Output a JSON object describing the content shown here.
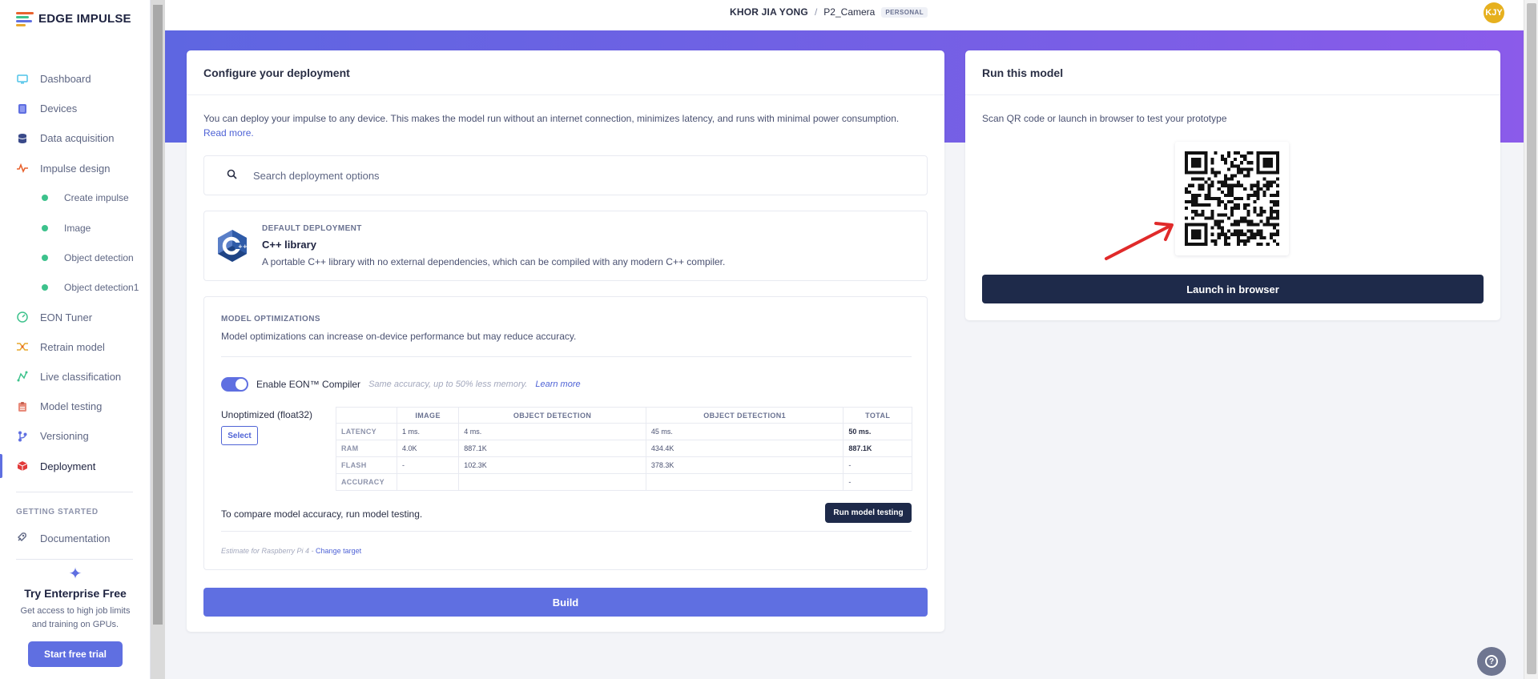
{
  "app": {
    "logo_text": "EDGE IMPULSE"
  },
  "header": {
    "owner": "KHOR JIA YONG",
    "separator": "/",
    "project": "P2_Camera",
    "badge": "PERSONAL",
    "avatar_initials": "KJY"
  },
  "sidebar": {
    "items": [
      {
        "label": "Dashboard",
        "icon": "monitor-icon",
        "color": "#4fc3e8"
      },
      {
        "label": "Devices",
        "icon": "device-icon",
        "color": "#5f6fe1"
      },
      {
        "label": "Data acquisition",
        "icon": "database-icon",
        "color": "#3a4a8a"
      },
      {
        "label": "Impulse design",
        "icon": "pulse-icon",
        "color": "#e8622e"
      },
      {
        "label": "Create impulse",
        "sub": true
      },
      {
        "label": "Image",
        "sub": true
      },
      {
        "label": "Object detection",
        "sub": true
      },
      {
        "label": "Object detection1",
        "sub": true
      },
      {
        "label": "EON Tuner",
        "icon": "gauge-icon",
        "color": "#3dc28c"
      },
      {
        "label": "Retrain model",
        "icon": "shuffle-icon",
        "color": "#e8a92e"
      },
      {
        "label": "Live classification",
        "icon": "graph-icon",
        "color": "#3dc28c"
      },
      {
        "label": "Model testing",
        "icon": "clipboard-icon",
        "color": "#e88a7a"
      },
      {
        "label": "Versioning",
        "icon": "branch-icon",
        "color": "#5f6fe1"
      },
      {
        "label": "Deployment",
        "icon": "box-icon",
        "color": "#e23a3a",
        "active": true
      }
    ],
    "getting_started_label": "GETTING STARTED",
    "documentation_label": "Documentation",
    "enterprise_title": "Try Enterprise Free",
    "enterprise_text_1": "Get access to high job limits",
    "enterprise_text_2": "and training on GPUs.",
    "trial_button": "Start free trial"
  },
  "deploy": {
    "title": "Configure your deployment",
    "description": "You can deploy your impulse to any device. This makes the model run without an internet connection, minimizes latency, and runs with minimal power consumption.",
    "read_more": "Read more.",
    "search_placeholder": "Search deployment options",
    "default_label": "DEFAULT DEPLOYMENT",
    "default_name": "C++ library",
    "default_desc": "A portable C++ library with no external dependencies, which can be compiled with any modern C++ compiler.",
    "opt_label": "MODEL OPTIMIZATIONS",
    "opt_note": "Model optimizations can increase on-device performance but may reduce accuracy.",
    "eon_label": "Enable EON™ Compiler",
    "eon_hint": "Same accuracy, up to 50% less memory.",
    "eon_link": "Learn more",
    "eon_enabled": true,
    "unoptimized_label": "Unoptimized (float32)",
    "select_button": "Select",
    "table": {
      "headers": [
        "",
        "IMAGE",
        "OBJECT DETECTION",
        "OBJECT DETECTION1",
        "TOTAL"
      ],
      "rows": [
        [
          "LATENCY",
          "1 ms.",
          "4 ms.",
          "45 ms.",
          "50 ms."
        ],
        [
          "RAM",
          "4.0K",
          "887.1K",
          "434.4K",
          "887.1K"
        ],
        [
          "FLASH",
          "-",
          "102.3K",
          "378.3K",
          "-"
        ],
        [
          "ACCURACY",
          "",
          "",
          "",
          "-"
        ]
      ]
    },
    "compare_text": "To compare model accuracy, run model testing.",
    "run_testing_button": "Run model testing",
    "estimate_text": "Estimate for Raspberry Pi 4 - ",
    "change_target": "Change target",
    "build_button": "Build"
  },
  "run": {
    "title": "Run this model",
    "description": "Scan QR code or launch in browser to test your prototype",
    "launch_button": "Launch in browser"
  },
  "colors": {
    "accent": "#5f6fe1",
    "dark_button": "#1e2a4a",
    "arrow": "#e02a2a",
    "success_dot": "#3dc28c"
  }
}
